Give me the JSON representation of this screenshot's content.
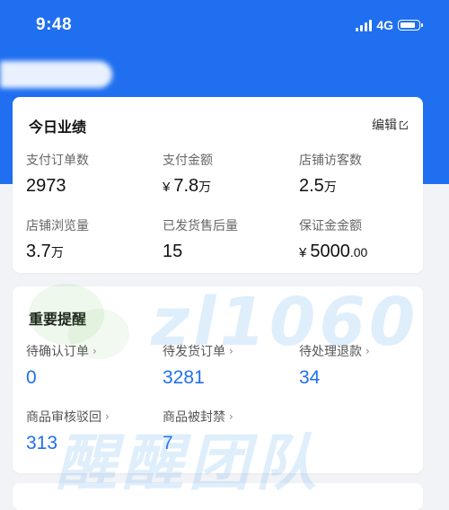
{
  "status_bar": {
    "time": "9:48",
    "network": "4G"
  },
  "performance": {
    "title": "今日业绩",
    "edit_label": "编辑",
    "metrics": [
      {
        "label": "支付订单数",
        "value": "2973"
      },
      {
        "label": "支付金额",
        "currency": "¥",
        "value": "7.8",
        "unit": "万"
      },
      {
        "label": "店铺访客数",
        "value": "2.5",
        "unit": "万"
      },
      {
        "label": "店铺浏览量",
        "value": "3.7",
        "unit": "万"
      },
      {
        "label": "已发货售后量",
        "value": "15"
      },
      {
        "label": "保证金金额",
        "currency": "¥",
        "value": "5000",
        "decimal": ".00"
      }
    ]
  },
  "alerts": {
    "title": "重要提醒",
    "items": [
      {
        "label": "待确认订单",
        "value": "0"
      },
      {
        "label": "待发货订单",
        "value": "3281"
      },
      {
        "label": "待处理退款",
        "value": "34"
      },
      {
        "label": "商品审核驳回",
        "value": "313"
      },
      {
        "label": "商品被封禁",
        "value": "7"
      }
    ]
  },
  "watermark": {
    "latin": "zl1060",
    "chinese": "醒醒团队"
  },
  "colors": {
    "brand_blue": "#1f6ff0",
    "alert_value": "#1f6ff0",
    "page_bg": "#f2f3f7"
  },
  "icons": [
    "signal-icon",
    "battery-icon",
    "edit-icon",
    "chevron-right-icon",
    "wechat-logo"
  ]
}
